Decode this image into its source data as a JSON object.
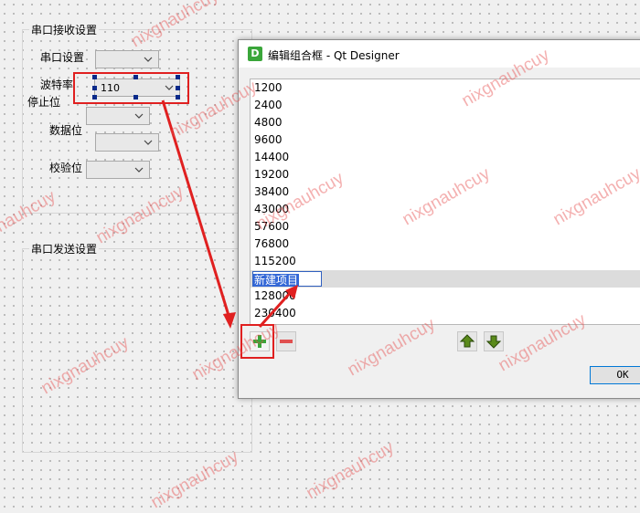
{
  "receive_group": {
    "title": "串口接收设置",
    "port_label": "串口设置",
    "baud_label": "波特率",
    "stop_label": "停止位",
    "data_label": "数据位",
    "parity_label": "校验位",
    "baud_value": "110"
  },
  "send_group": {
    "title": "串口发送设置"
  },
  "dialog": {
    "title": "编辑组合框 - Qt Designer",
    "app_icon_letter": "D",
    "items": [
      "1200",
      "2400",
      "4800",
      "9600",
      "14400",
      "19200",
      "38400",
      "43000",
      "57600",
      "76800",
      "115200"
    ],
    "editing_item": "新建项目",
    "items_after": [
      "128000",
      "230400"
    ],
    "ok_label": "OK"
  },
  "watermark": "nixgnauhcuy",
  "colors": {
    "annotation_red": "#e02020",
    "handle_blue": "#0a2a8a",
    "add_green": "#3aa63a",
    "remove_red": "#e05050"
  }
}
